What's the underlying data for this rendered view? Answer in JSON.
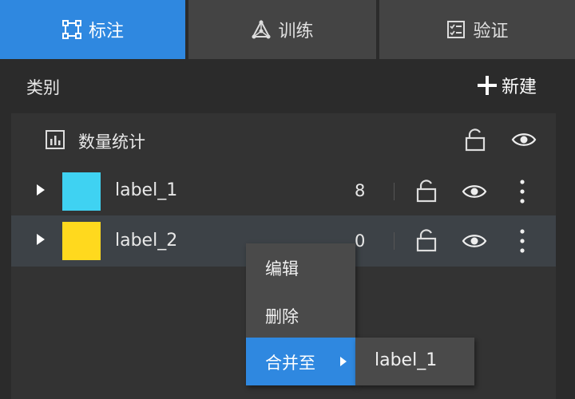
{
  "tabs": [
    {
      "label": "标注",
      "icon": "annotate-icon",
      "active": true
    },
    {
      "label": "训练",
      "icon": "network-icon",
      "active": false
    },
    {
      "label": "验证",
      "icon": "checklist-icon",
      "active": false
    }
  ],
  "header": {
    "category_label": "类别",
    "new_label": "新建"
  },
  "stats": {
    "label": "数量统计"
  },
  "labels": [
    {
      "name": "label_1",
      "count": "8",
      "color": "#3fd2f2"
    },
    {
      "name": "label_2",
      "count": "0",
      "color": "#ffd91e"
    }
  ],
  "context_menu": {
    "items": [
      "编辑",
      "删除",
      "合并至"
    ],
    "submenu": [
      "label_1"
    ]
  },
  "colors": {
    "accent": "#2f88e0"
  }
}
